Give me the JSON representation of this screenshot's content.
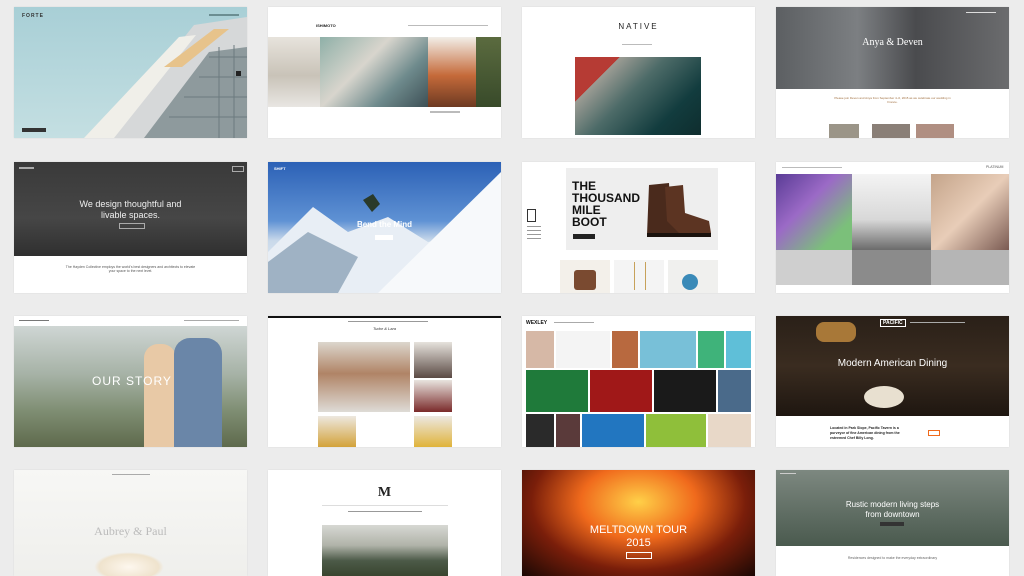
{
  "tiles": {
    "forte": {
      "logo": "FORTE"
    },
    "ishimoto": {
      "logo": "ISHIMOTO"
    },
    "native": {
      "logo": "NATIVE"
    },
    "anya": {
      "title": "Anya & Deven",
      "body": "Please join Deven and Anya from September 4–6, 2015 as we celebrate our wedding in France."
    },
    "hayden": {
      "title_line1": "We design thoughtful and",
      "title_line2": "livable spaces.",
      "body": "The Hayden Collective employs the world's best designers and architects to elevate your space to the next level."
    },
    "shift": {
      "logo": "SHIFT",
      "headline": "Bend the Mind"
    },
    "boot": {
      "line1": "THE",
      "line2": "THOUSAND",
      "line3": "MILE",
      "line4": "BOOT"
    },
    "platinum": {
      "logo": "PLATINUM"
    },
    "story": {
      "headline": "OUR STORY"
    },
    "tudor": {
      "logo": "Tudor & Lara"
    },
    "wexley": {
      "logo": "WEXLEY"
    },
    "pacific": {
      "logo": "PACIFIC",
      "headline": "Modern American Dining",
      "body_line1": "Located in Park Slope, Pacific Tavern is a",
      "body_line2": "purveyor of fine American dining from the",
      "body_line3": "esteemed Chef Billy Long."
    },
    "aubrey": {
      "headline": "Aubrey & Paul"
    },
    "m": {
      "logo": "M"
    },
    "meltdown": {
      "headline_line1": "MELTDOWN TOUR",
      "headline_line2": "2015"
    },
    "rustic": {
      "headline_line1": "Rustic modern living steps",
      "headline_line2": "from downtown",
      "body": "Residences designed to make the everyday extraordinary"
    }
  },
  "colors": {
    "page_bg": "#ececec",
    "accent_orange": "#f06a1c"
  }
}
